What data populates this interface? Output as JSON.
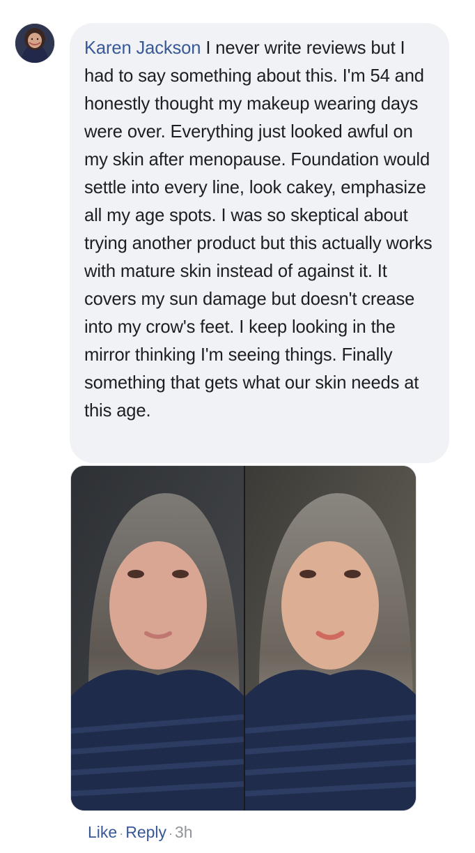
{
  "comment": {
    "author": "Karen Jackson",
    "text": "I never write reviews but I had to say something about this. I'm 54 and honestly thought my makeup wearing days were over. Everything just looked awful on my skin after menopause. Foundation would settle into every line, look cakey, emphasize all my age spots. I was so skeptical about trying another product but this actually works with mature skin instead of against it. It covers my sun damage but doesn't crease into my crow's feet. I keep looking in the mirror thinking I'm seeing things. Finally something that gets what our skin needs at this age."
  },
  "actions": {
    "like_label": "Like",
    "reply_label": "Reply",
    "separator": "·",
    "time": "3h"
  },
  "colors": {
    "link": "#385898",
    "bubble": "#f0f2f5",
    "meta": "#90949c"
  },
  "icons": {
    "avatar": "profile-photo"
  }
}
